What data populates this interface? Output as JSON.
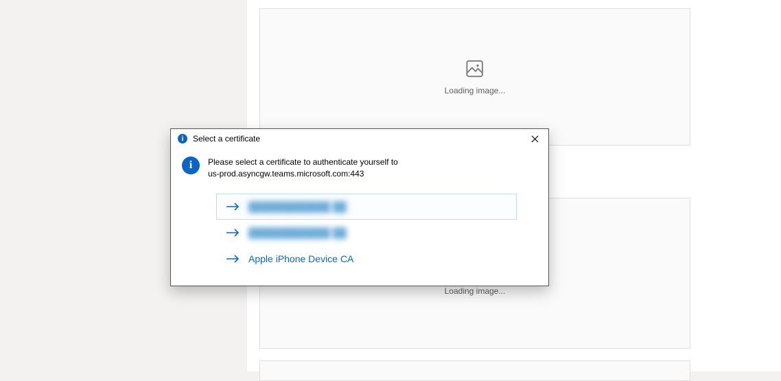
{
  "background": {
    "card1_loading": "Loading image...",
    "card2_loading": "Loading image..."
  },
  "dialog": {
    "title": "Select a certificate",
    "message_line1": "Please select a certificate to authenticate yourself to",
    "message_line2": "us-prod.asyncgw.teams.microsoft.com:443",
    "certificates": [
      {
        "label": "████████████ ██",
        "blurred": true,
        "selected": true
      },
      {
        "label": "████████████ ██",
        "blurred": true,
        "selected": false
      },
      {
        "label": "Apple iPhone Device CA",
        "blurred": false,
        "selected": false
      }
    ]
  }
}
